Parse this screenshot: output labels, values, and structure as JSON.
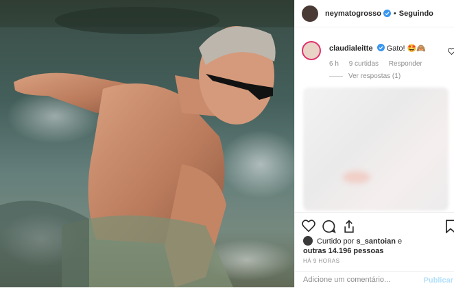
{
  "post": {
    "author": "neymatogrosso",
    "follow_status": "Seguindo",
    "dot": "•"
  },
  "comment": {
    "username": "claudialeitte",
    "text": "Gato! 🤩🙈",
    "time": "6 h",
    "likes": "9 curtidas",
    "reply": "Responder",
    "view_replies": "Ver respostas (1)"
  },
  "likes": {
    "prefix": "Curtido por",
    "user": "s_santoian",
    "connector": "e",
    "others": "outras 14.196 pessoas"
  },
  "timestamp": "HÁ 9 HORAS",
  "add_comment": {
    "placeholder": "Adicione um comentário...",
    "publish_label": "Publicar"
  },
  "colors": {
    "verified": "#3897f0",
    "story_ring": "#e1306c"
  }
}
